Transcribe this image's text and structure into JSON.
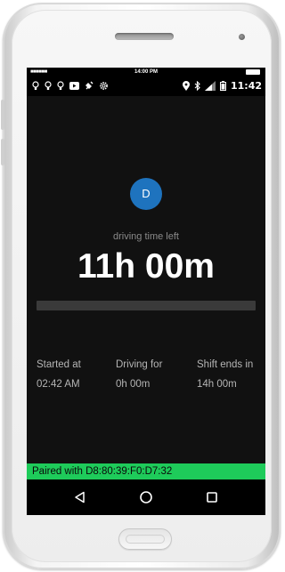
{
  "device": {
    "carrier_dots": "■■■■■■",
    "carrier_time": "14:00 PM"
  },
  "status_bar": {
    "clock": "11:42",
    "left_icons": [
      "bulb-icon",
      "bulb-icon",
      "bulb-icon",
      "youtube-icon",
      "plug-icon",
      "settings-gear-icon"
    ],
    "right_icons": [
      "location-icon",
      "bluetooth-icon",
      "signal-icon",
      "battery-icon"
    ]
  },
  "app": {
    "avatar_initial": "D",
    "driving_label": "driving time left",
    "driving_value": "11h 00m",
    "progress_fraction": 0,
    "stats": {
      "started_label": "Started at",
      "started_value": "02:42 AM",
      "driving_label": "Driving for",
      "driving_value": "0h 00m",
      "shift_label": "Shift ends in",
      "shift_value": "14h 00m"
    },
    "paired_text": "Paired with D8:80:39:F0:D7:32"
  },
  "nav": {
    "back_icon": "back-triangle-icon",
    "home_icon": "home-circle-icon",
    "recent_icon": "recent-square-icon"
  },
  "colors": {
    "background": "#111111",
    "avatar": "#1e73be",
    "paired_bar": "#1ecb5a",
    "progress_track": "#3a3a3a"
  }
}
